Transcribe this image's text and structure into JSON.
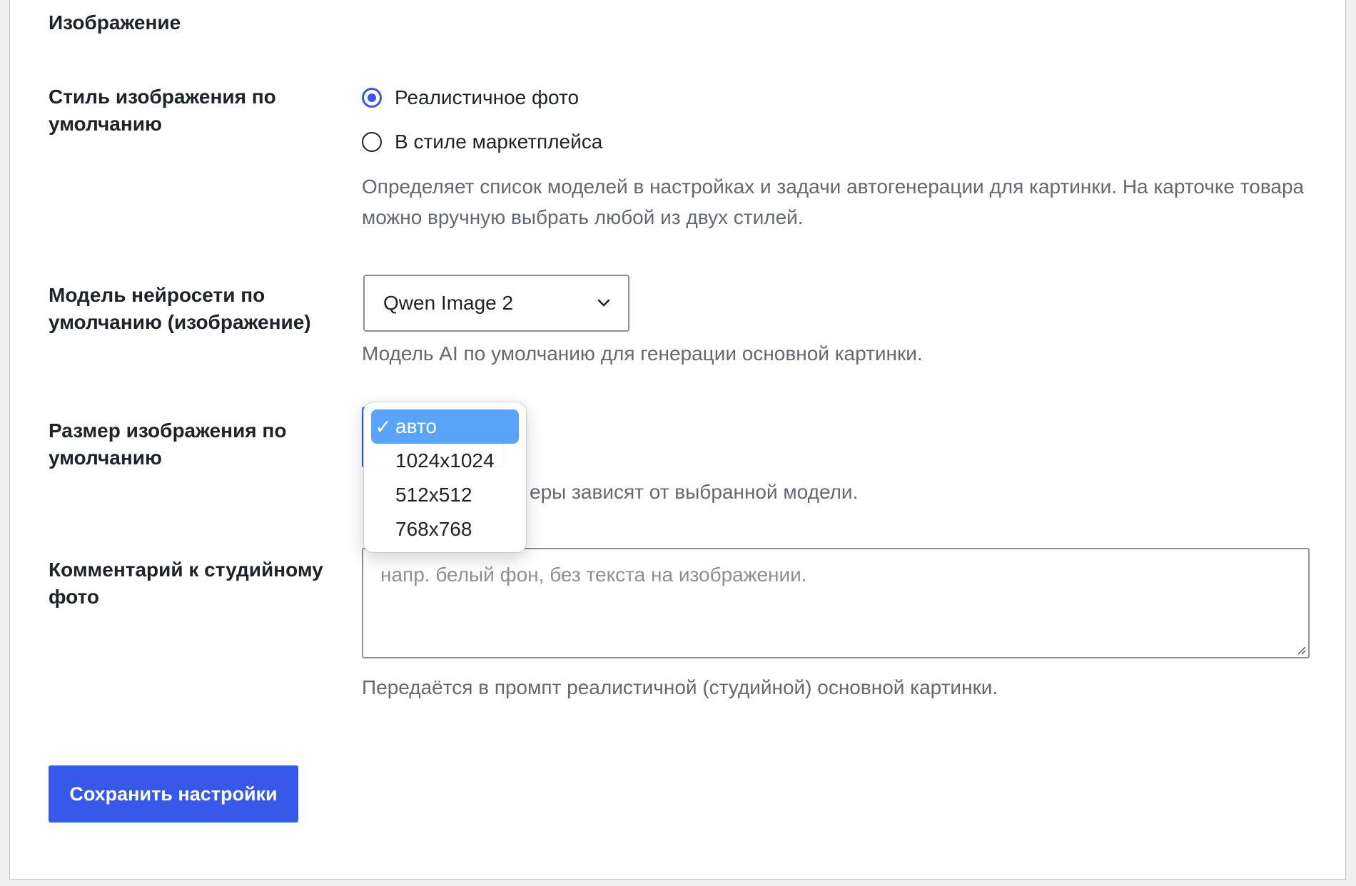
{
  "section": {
    "title": "Изображение"
  },
  "style_field": {
    "label": "Стиль изображения по умолчанию",
    "options": [
      {
        "label": "Реалистичное фото",
        "checked": true
      },
      {
        "label": "В стиле маркетплейса",
        "checked": false
      }
    ],
    "description": "Определяет список моделей в настройках и задачи автогенерации для картинки. На карточке товара можно вручную выбрать любой из двух стилей."
  },
  "model_field": {
    "label": "Модель нейросети по умолчанию (изображение)",
    "selected_value": "Qwen Image 2",
    "description": "Модель AI по умолчанию для генерации основной картинки.",
    "icon": "chevron-down-icon"
  },
  "size_field": {
    "label": "Размер изображения по умолчанию",
    "description_visible": "еры зависят от выбранной модели.",
    "dropdown": {
      "check_mark": "✓",
      "options": [
        {
          "label": "авто",
          "selected": true
        },
        {
          "label": "1024x1024",
          "selected": false
        },
        {
          "label": "512x512",
          "selected": false
        },
        {
          "label": "768x768",
          "selected": false
        }
      ],
      "selected_color": "#5aa3fb"
    }
  },
  "comment_field": {
    "label": "Комментарий к студийному фото",
    "placeholder": "напр. белый фон, без текста на изображении.",
    "description": "Передаётся в промпт реалистичной (студийной) основной картинки."
  },
  "actions": {
    "save_label": "Сохранить настройки"
  },
  "colors": {
    "accent": "#3858e9",
    "muted_text": "#646970",
    "text": "#1d2327"
  }
}
